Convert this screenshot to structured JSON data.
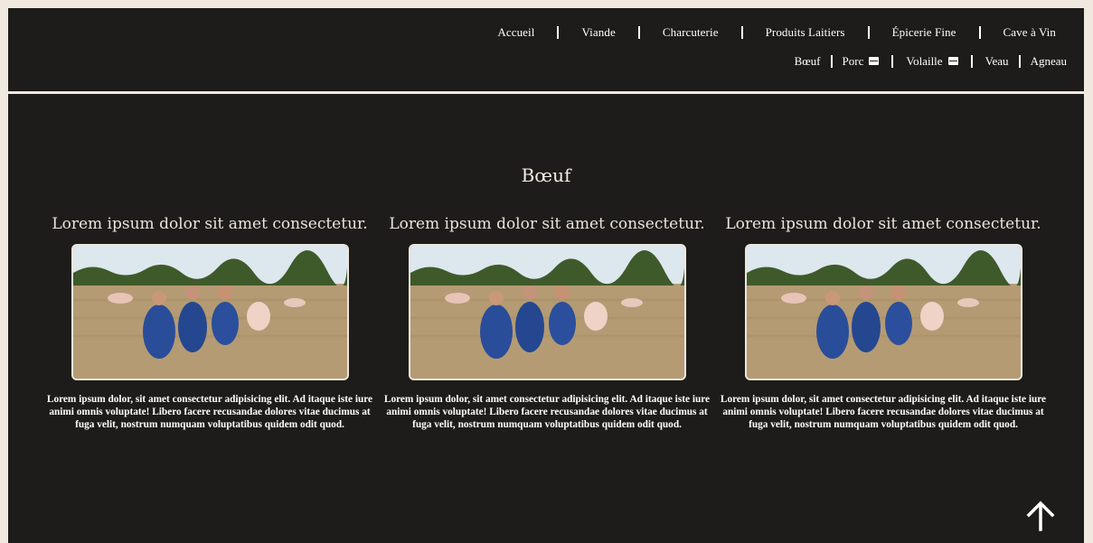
{
  "nav": {
    "main": [
      "Accueil",
      "Viande",
      "Charcuterie",
      "Produits Laitiers",
      "Épicerie Fine",
      "Cave à Vin"
    ],
    "sub": [
      {
        "label": "Bœuf",
        "icon": null
      },
      {
        "label": "Porc",
        "icon": "shop-icon"
      },
      {
        "label": "Volaille",
        "icon": "shop-icon"
      },
      {
        "label": "Veau",
        "icon": null
      },
      {
        "label": "Agneau",
        "icon": null
      }
    ]
  },
  "section": {
    "title": "Bœuf"
  },
  "cards": [
    {
      "title": "Lorem ipsum dolor sit amet consectetur.",
      "text": "Lorem ipsum dolor, sit amet consectetur adipisicing elit. Ad itaque iste iure animi omnis voluptate! Libero facere recusandae dolores vitae ducimus at fuga velit, nostrum numquam voluptatibus quidem odit quod."
    },
    {
      "title": "Lorem ipsum dolor sit amet consectetur.",
      "text": "Lorem ipsum dolor, sit amet consectetur adipisicing elit. Ad itaque iste iure animi omnis voluptate! Libero facere recusandae dolores vitae ducimus at fuga velit, nostrum numquam voluptatibus quidem odit quod."
    },
    {
      "title": "Lorem ipsum dolor sit amet consectetur.",
      "text": "Lorem ipsum dolor, sit amet consectetur adipisicing elit. Ad itaque iste iure animi omnis voluptate! Libero facere recusandae dolores vitae ducimus at fuga velit, nostrum numquam voluptatibus quidem odit quod."
    }
  ],
  "icons": {
    "scroll_top": "arrow-up-icon"
  },
  "colors": {
    "background": "#1e1c1a",
    "page": "#efe9df",
    "text": "#ffffff"
  }
}
